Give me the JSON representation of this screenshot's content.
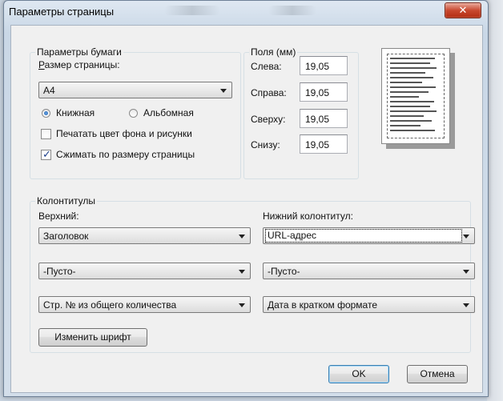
{
  "window": {
    "title": "Параметры страницы",
    "close_glyph": "✕"
  },
  "paper": {
    "legend": "Параметры бумаги",
    "size_label": "Размер страницы:",
    "size_value": "A4",
    "portrait_label": "Книжная",
    "landscape_label": "Альбомная",
    "orientation_selected": "portrait",
    "print_bg_label": "Печатать цвет фона и рисунки",
    "print_bg_checked": false,
    "shrink_label": "Сжимать по размеру страницы",
    "shrink_checked": true
  },
  "margins": {
    "legend": "Поля (мм)",
    "left_label": "Слева:",
    "left_value": "19,05",
    "right_label": "Справа:",
    "right_value": "19,05",
    "top_label": "Сверху:",
    "top_value": "19,05",
    "bottom_label": "Снизу:",
    "bottom_value": "19,05"
  },
  "headers": {
    "legend": "Колонтитулы",
    "header_label": "Верхний:",
    "footer_label": "Нижний колонтитул:",
    "header1": "Заголовок",
    "header2": "-Пусто-",
    "header3": "Стр. № из общего количества",
    "footer1": "URL-адрес",
    "footer2": "-Пусто-",
    "footer3": "Дата в кратком формате",
    "font_button": "Изменить шрифт"
  },
  "buttons": {
    "ok": "OK",
    "cancel": "Отмена"
  },
  "icons": {
    "close": "close-icon",
    "dropdown": "chevron-down-icon",
    "check": "checkmark-icon"
  }
}
